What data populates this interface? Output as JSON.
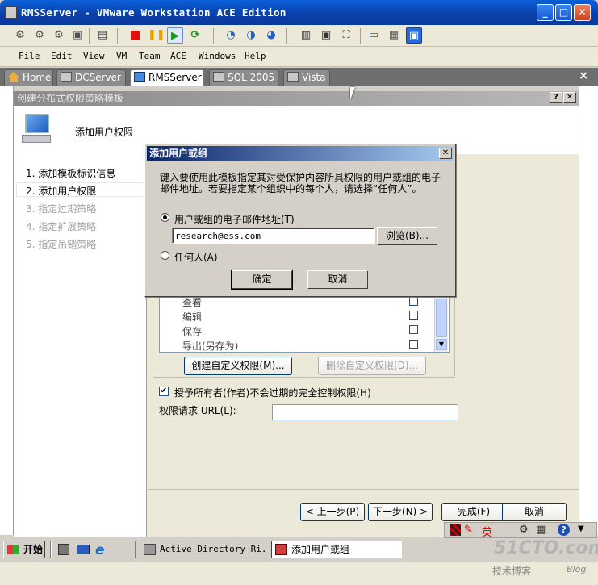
{
  "window": {
    "title": "RMSServer - VMware Workstation ACE Edition"
  },
  "menu": [
    "File",
    "Edit",
    "View",
    "VM",
    "Team",
    "ACE",
    "Windows",
    "Help"
  ],
  "tabs": [
    {
      "label": "Home",
      "active": false
    },
    {
      "label": "DCServer",
      "active": false
    },
    {
      "label": "RMSServer",
      "active": true
    },
    {
      "label": "SQL 2005",
      "active": false
    },
    {
      "label": "Vista",
      "active": false
    }
  ],
  "tab_close": "×",
  "wizard": {
    "title": "创建分布式权限策略模板",
    "header": "添加用户权限",
    "steps": [
      "1. 添加模板标识信息",
      "2. 添加用户权限",
      "3. 指定过期策略",
      "4. 指定扩展策略",
      "5. 指定吊销策略"
    ],
    "permissions": [
      "查看",
      "编辑",
      "保存",
      "导出(另存为)"
    ],
    "create_custom": "创建自定义权限(M)...",
    "delete_custom": "删除自定义权限(D)...",
    "grant_owner": "授予所有者(作者)不会过期的完全控制权限(H)",
    "rights_url_label": "权限请求 URL(L):",
    "rights_url_value": "",
    "back": "< 上一步(P)",
    "next": "下一步(N) >",
    "finish": "完成(F)",
    "cancel": "取消"
  },
  "dialog": {
    "title": "添加用户或组",
    "description": "键入要使用此模板指定其对受保护内容所具权限的用户或组的电子邮件地址。若要指定某个组织中的每个人，请选择“任何人”。",
    "option_email": "用户或组的电子邮件地址(T)",
    "email_value": "research@ess.com",
    "browse": "浏览(B)...",
    "option_anyone": "任何人(A)",
    "ok": "确定",
    "cancel": "取消"
  },
  "taskbar": {
    "start": "开始",
    "items": [
      "Active Directory Ri...",
      "添加用户或组"
    ],
    "ime": "英"
  },
  "watermark": {
    "site": "51CTO.com",
    "sub": "技术博客",
    "blog": "Blog"
  },
  "colors": {
    "xp_blue": "#0a3a9c",
    "dialog_title": "#0a246a",
    "tab_strip": "#6f6f6f"
  }
}
